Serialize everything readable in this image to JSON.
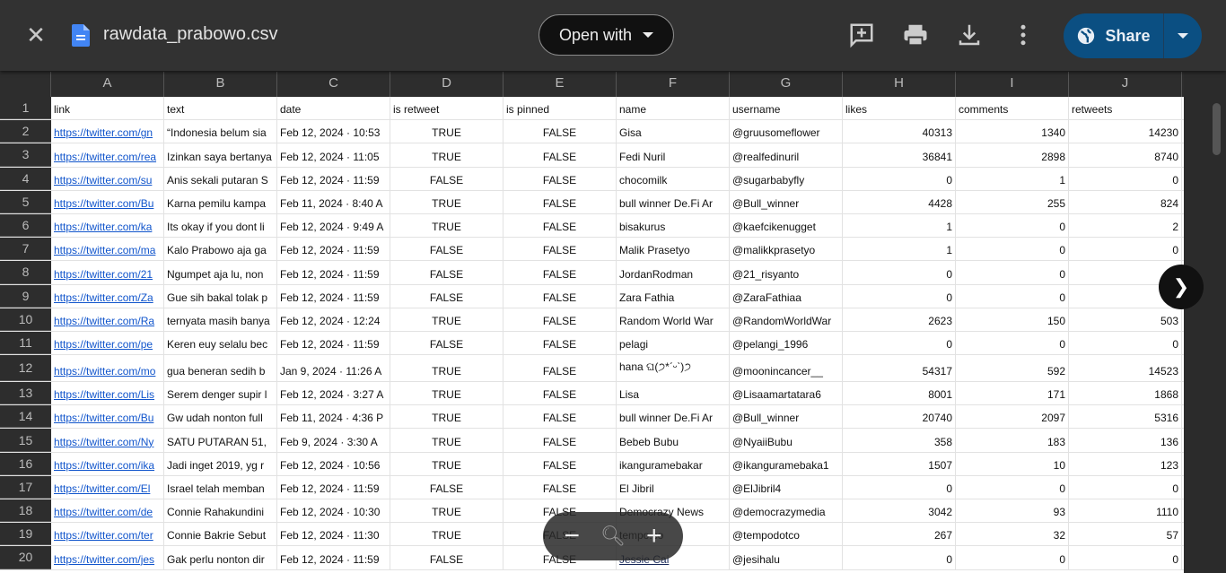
{
  "header": {
    "file_name": "rawdata_prabowo.csv",
    "open_with": "Open with",
    "share": "Share"
  },
  "columns": [
    "A",
    "B",
    "C",
    "D",
    "E",
    "F",
    "G",
    "H",
    "I",
    "J"
  ],
  "align": [
    "l",
    "l",
    "l",
    "c",
    "c",
    "l",
    "l",
    "r",
    "r",
    "r"
  ],
  "rows": [
    [
      "link",
      "text",
      "date",
      "is retweet",
      "is pinned",
      "name",
      "username",
      "likes",
      "comments",
      "retweets"
    ],
    [
      "https://twitter.com/gn",
      "“Indonesia belum sia",
      "Feb 12, 2024 · 10:53",
      "TRUE",
      "FALSE",
      "Gisa",
      "@gruusomeflower",
      "40313",
      "1340",
      "14230"
    ],
    [
      "https://twitter.com/rea",
      "Izinkan saya bertanya",
      "Feb 12, 2024 · 11:05",
      "TRUE",
      "FALSE",
      "Fedi Nuril",
      "@realfedinuril",
      "36841",
      "2898",
      "8740"
    ],
    [
      "https://twitter.com/su",
      "Anis sekali putaran S",
      "Feb 12, 2024 · 11:59",
      "FALSE",
      "FALSE",
      "chocomilk",
      "@sugarbabyfly",
      "0",
      "1",
      "0"
    ],
    [
      "https://twitter.com/Bu",
      "Karna pemilu kampa",
      "Feb 11, 2024 · 8:40 A",
      "TRUE",
      "FALSE",
      "bull winner  De.Fi Ar",
      "@Bull_winner",
      "4428",
      "255",
      "824"
    ],
    [
      "https://twitter.com/ka",
      "Its okay if you dont li",
      "Feb 12, 2024 · 9:49 A",
      "TRUE",
      "FALSE",
      "bisakurus",
      "@kaefcikenugget",
      "1",
      "0",
      "2"
    ],
    [
      "https://twitter.com/ma",
      "Kalo Prabowo aja ga",
      "Feb 12, 2024 · 11:59",
      "FALSE",
      "FALSE",
      "Malik Prasetyo",
      "@malikkprasetyo",
      "1",
      "0",
      "0"
    ],
    [
      "https://twitter.com/21",
      "Ngumpet aja lu, non",
      "Feb 12, 2024 · 11:59",
      "FALSE",
      "FALSE",
      "JordanRodman",
      "@21_risyanto",
      "0",
      "0",
      ""
    ],
    [
      "https://twitter.com/Za",
      "Gue sih bakal tolak p",
      "Feb 12, 2024 · 11:59",
      "FALSE",
      "FALSE",
      "Zara Fathia",
      "@ZaraFathiaa",
      "0",
      "0",
      ""
    ],
    [
      "https://twitter.com/Ra",
      "ternyata masih banya",
      "Feb 12, 2024 · 12:24",
      "TRUE",
      "FALSE",
      "Random World War",
      "@RandomWorldWar",
      "2623",
      "150",
      "503"
    ],
    [
      "https://twitter.com/pe",
      "Keren euy selalu bec",
      "Feb 12, 2024 · 11:59",
      "FALSE",
      "FALSE",
      "pelagi",
      "@pelangi_1996",
      "0",
      "0",
      "0"
    ],
    [
      "https://twitter.com/mo",
      "gua beneran sedih b",
      "Jan 9, 2024 · 11:26 A",
      "TRUE",
      "FALSE",
      "hana ଘ(੭*ˊᵕˋ)੭",
      "@moonincancer__",
      "54317",
      "592",
      "14523"
    ],
    [
      "https://twitter.com/Lis",
      "Serem denger supir l",
      "Feb 12, 2024 · 3:27 A",
      "TRUE",
      "FALSE",
      "Lisa",
      "@Lisaamartatara6",
      "8001",
      "171",
      "1868"
    ],
    [
      "https://twitter.com/Bu",
      "Gw udah nonton full",
      "Feb 11, 2024 · 4:36 P",
      "TRUE",
      "FALSE",
      "bull winner  De.Fi Ar",
      "@Bull_winner",
      "20740",
      "2097",
      "5316"
    ],
    [
      "https://twitter.com/Ny",
      "SATU PUTARAN 51,",
      "Feb 9, 2024 · 3:30 A",
      "TRUE",
      "FALSE",
      " Bebeb Bubu",
      "@NyaiiBubu",
      "358",
      "183",
      "136"
    ],
    [
      "https://twitter.com/ika",
      "Jadi inget 2019, yg r",
      "Feb 12, 2024 · 10:56",
      "TRUE",
      "FALSE",
      "ikanguramebakar",
      "@ikanguramebaka1",
      "1507",
      "10",
      "123"
    ],
    [
      "https://twitter.com/El",
      "Israel telah memban",
      "Feb 12, 2024 · 11:59",
      "FALSE",
      "FALSE",
      "El Jibril",
      "@ElJibril4",
      "0",
      "0",
      "0"
    ],
    [
      "https://twitter.com/de",
      "Connie Rahakundini",
      "Feb 12, 2024 · 10:30",
      "TRUE",
      "FALSE",
      "Democrazy News",
      "@democrazymedia",
      "3042",
      "93",
      "1110"
    ],
    [
      "https://twitter.com/ter",
      "Connie Bakrie Sebut",
      "Feb 12, 2024 · 11:30",
      "TRUE",
      "FALSE",
      "tempo.co",
      "@tempodotco",
      "267",
      "32",
      "57"
    ],
    [
      "https://twitter.com/jes",
      "Gak perlu nonton dir",
      "Feb 12, 2024 · 11:59",
      "FALSE",
      "FALSE",
      "Jessie Cai",
      "@jesihalu",
      "0",
      "0",
      "0"
    ]
  ],
  "link_cells_col": [
    0
  ],
  "link_name_row": 19,
  "colors": {
    "topbar": "#323232",
    "share": "#0b4f82",
    "link": "#1155cc"
  }
}
